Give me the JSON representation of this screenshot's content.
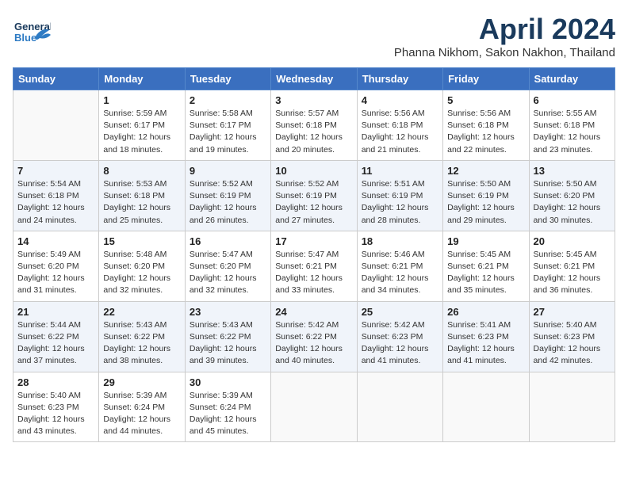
{
  "header": {
    "logo_general": "General",
    "logo_blue": "Blue",
    "month_title": "April 2024",
    "location": "Phanna Nikhom, Sakon Nakhon, Thailand"
  },
  "columns": [
    "Sunday",
    "Monday",
    "Tuesday",
    "Wednesday",
    "Thursday",
    "Friday",
    "Saturday"
  ],
  "weeks": [
    [
      {
        "day": "",
        "info": ""
      },
      {
        "day": "1",
        "info": "Sunrise: 5:59 AM\nSunset: 6:17 PM\nDaylight: 12 hours\nand 18 minutes."
      },
      {
        "day": "2",
        "info": "Sunrise: 5:58 AM\nSunset: 6:17 PM\nDaylight: 12 hours\nand 19 minutes."
      },
      {
        "day": "3",
        "info": "Sunrise: 5:57 AM\nSunset: 6:18 PM\nDaylight: 12 hours\nand 20 minutes."
      },
      {
        "day": "4",
        "info": "Sunrise: 5:56 AM\nSunset: 6:18 PM\nDaylight: 12 hours\nand 21 minutes."
      },
      {
        "day": "5",
        "info": "Sunrise: 5:56 AM\nSunset: 6:18 PM\nDaylight: 12 hours\nand 22 minutes."
      },
      {
        "day": "6",
        "info": "Sunrise: 5:55 AM\nSunset: 6:18 PM\nDaylight: 12 hours\nand 23 minutes."
      }
    ],
    [
      {
        "day": "7",
        "info": "Sunrise: 5:54 AM\nSunset: 6:18 PM\nDaylight: 12 hours\nand 24 minutes."
      },
      {
        "day": "8",
        "info": "Sunrise: 5:53 AM\nSunset: 6:18 PM\nDaylight: 12 hours\nand 25 minutes."
      },
      {
        "day": "9",
        "info": "Sunrise: 5:52 AM\nSunset: 6:19 PM\nDaylight: 12 hours\nand 26 minutes."
      },
      {
        "day": "10",
        "info": "Sunrise: 5:52 AM\nSunset: 6:19 PM\nDaylight: 12 hours\nand 27 minutes."
      },
      {
        "day": "11",
        "info": "Sunrise: 5:51 AM\nSunset: 6:19 PM\nDaylight: 12 hours\nand 28 minutes."
      },
      {
        "day": "12",
        "info": "Sunrise: 5:50 AM\nSunset: 6:19 PM\nDaylight: 12 hours\nand 29 minutes."
      },
      {
        "day": "13",
        "info": "Sunrise: 5:50 AM\nSunset: 6:20 PM\nDaylight: 12 hours\nand 30 minutes."
      }
    ],
    [
      {
        "day": "14",
        "info": "Sunrise: 5:49 AM\nSunset: 6:20 PM\nDaylight: 12 hours\nand 31 minutes."
      },
      {
        "day": "15",
        "info": "Sunrise: 5:48 AM\nSunset: 6:20 PM\nDaylight: 12 hours\nand 32 minutes."
      },
      {
        "day": "16",
        "info": "Sunrise: 5:47 AM\nSunset: 6:20 PM\nDaylight: 12 hours\nand 32 minutes."
      },
      {
        "day": "17",
        "info": "Sunrise: 5:47 AM\nSunset: 6:21 PM\nDaylight: 12 hours\nand 33 minutes."
      },
      {
        "day": "18",
        "info": "Sunrise: 5:46 AM\nSunset: 6:21 PM\nDaylight: 12 hours\nand 34 minutes."
      },
      {
        "day": "19",
        "info": "Sunrise: 5:45 AM\nSunset: 6:21 PM\nDaylight: 12 hours\nand 35 minutes."
      },
      {
        "day": "20",
        "info": "Sunrise: 5:45 AM\nSunset: 6:21 PM\nDaylight: 12 hours\nand 36 minutes."
      }
    ],
    [
      {
        "day": "21",
        "info": "Sunrise: 5:44 AM\nSunset: 6:22 PM\nDaylight: 12 hours\nand 37 minutes."
      },
      {
        "day": "22",
        "info": "Sunrise: 5:43 AM\nSunset: 6:22 PM\nDaylight: 12 hours\nand 38 minutes."
      },
      {
        "day": "23",
        "info": "Sunrise: 5:43 AM\nSunset: 6:22 PM\nDaylight: 12 hours\nand 39 minutes."
      },
      {
        "day": "24",
        "info": "Sunrise: 5:42 AM\nSunset: 6:22 PM\nDaylight: 12 hours\nand 40 minutes."
      },
      {
        "day": "25",
        "info": "Sunrise: 5:42 AM\nSunset: 6:23 PM\nDaylight: 12 hours\nand 41 minutes."
      },
      {
        "day": "26",
        "info": "Sunrise: 5:41 AM\nSunset: 6:23 PM\nDaylight: 12 hours\nand 41 minutes."
      },
      {
        "day": "27",
        "info": "Sunrise: 5:40 AM\nSunset: 6:23 PM\nDaylight: 12 hours\nand 42 minutes."
      }
    ],
    [
      {
        "day": "28",
        "info": "Sunrise: 5:40 AM\nSunset: 6:23 PM\nDaylight: 12 hours\nand 43 minutes."
      },
      {
        "day": "29",
        "info": "Sunrise: 5:39 AM\nSunset: 6:24 PM\nDaylight: 12 hours\nand 44 minutes."
      },
      {
        "day": "30",
        "info": "Sunrise: 5:39 AM\nSunset: 6:24 PM\nDaylight: 12 hours\nand 45 minutes."
      },
      {
        "day": "",
        "info": ""
      },
      {
        "day": "",
        "info": ""
      },
      {
        "day": "",
        "info": ""
      },
      {
        "day": "",
        "info": ""
      }
    ]
  ]
}
